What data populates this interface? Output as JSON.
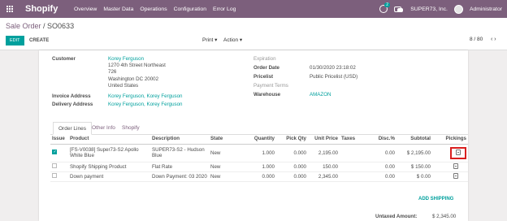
{
  "topbar": {
    "brand": "Shopify",
    "menu": [
      "Overview",
      "Master Data",
      "Operations",
      "Configuration",
      "Error Log"
    ],
    "badge": "2",
    "company": "SUPER73, Inc.",
    "user": "Administrator"
  },
  "breadcrumb": {
    "parent": "Sale Order",
    "sep": " / ",
    "current": "SO0633"
  },
  "buttons": {
    "edit": "EDIT",
    "create": "CREATE",
    "print": "Print ▾",
    "action": "Action ▾"
  },
  "pager": {
    "value": "8 / 80",
    "arrows": "‹  ›"
  },
  "form": {
    "customer_label": "Customer",
    "customer_name": "Korey Ferguson",
    "customer_addr1": "1270 4th Street Northeast",
    "customer_addr2": "726",
    "customer_addr3": "Washington DC 20002",
    "customer_addr4": "United States",
    "invoice_label": "Invoice Address",
    "invoice_value": "Korey Ferguson, Korey Ferguson",
    "delivery_label": "Delivery Address",
    "delivery_value": "Korey Ferguson, Korey Ferguson",
    "expiration_label": "Expiration",
    "order_date_label": "Order Date",
    "order_date_value": "01/30/2020 23:18:02",
    "pricelist_label": "Pricelist",
    "pricelist_value": "Public Pricelist (USD)",
    "payment_terms_label": "Payment Terms",
    "warehouse_label": "Warehouse",
    "warehouse_value": "AMAZON"
  },
  "tabs": [
    "Order Lines",
    "Other Info",
    "Shopify"
  ],
  "table": {
    "headers": [
      "Issue",
      "Product",
      "Description",
      "State",
      "Quantity",
      "Pick Qty",
      "Unit Price",
      "Taxes",
      "Disc.%",
      "Subtotal",
      "Pickings"
    ],
    "rows": [
      {
        "product": "[FS-V0038] Super73-S2 Apollo White Blue",
        "description": "SUPER73-S2 - Hudson",
        "description2": "Blue",
        "state": "New",
        "qty": "1.000",
        "pick": "0.000",
        "price": "2,195.00",
        "taxes": "",
        "disc": "0.00",
        "subtotal": "$ 2,195.00"
      },
      {
        "product": "Shopify Shipping Product",
        "description": "Flat Rate",
        "description2": "",
        "state": "New",
        "qty": "1.000",
        "pick": "0.000",
        "price": "150.00",
        "taxes": "",
        "disc": "0.00",
        "subtotal": "$ 150.00"
      },
      {
        "product": "Down payment",
        "description": "Down Payment: 03 2020",
        "description2": "",
        "state": "New",
        "qty": "0.000",
        "pick": "0.000",
        "price": "2,345.00",
        "taxes": "",
        "disc": "0.00",
        "subtotal": "$ 0.00"
      }
    ]
  },
  "add_shipping": "ADD SHIPPING",
  "untaxed_label": "Untaxed Amount:",
  "untaxed_value": "$ 2,345.00",
  "colors": {
    "brand": "#7c5f7c",
    "accent": "#00a09d",
    "highlight": "#d91f1f"
  }
}
